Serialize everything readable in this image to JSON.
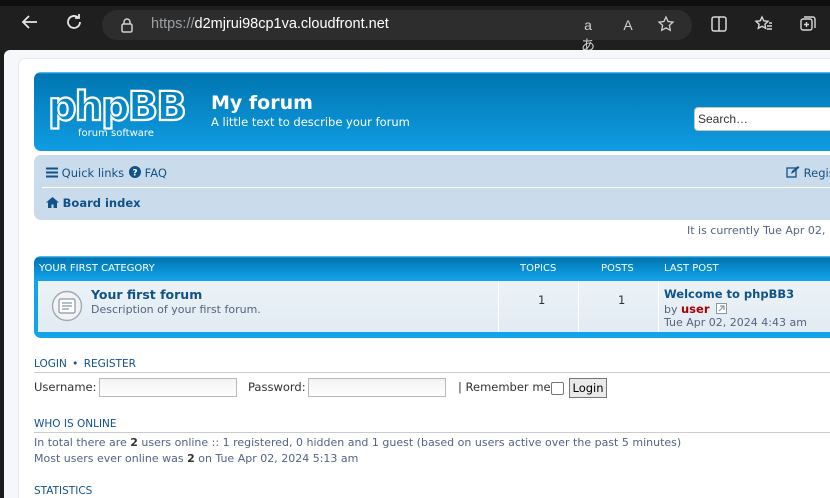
{
  "browser": {
    "url_scheme": "https://",
    "url_host": "d2mjrui98cp1va.cloudfront.net",
    "read_aloud_label": "A",
    "translate_label": "aあ"
  },
  "site": {
    "title": "My forum",
    "description": "A little text to describe your forum",
    "search_placeholder": "Search…",
    "logo_word": "phpBB",
    "logo_sub": "forum   software"
  },
  "navbar": {
    "quick_links": "Quick links",
    "faq": "FAQ",
    "register": "Regis",
    "board_index": "Board index"
  },
  "timestamp": "It is currently Tue Apr 02,",
  "category": {
    "name": "YOUR FIRST CATEGORY",
    "col_topics": "TOPICS",
    "col_posts": "POSTS",
    "col_last_post": "LAST POST",
    "forums": [
      {
        "title": "Your first forum",
        "description": "Description of your first forum.",
        "topics": "1",
        "posts": "1",
        "last_post_title": "Welcome to phpBB3",
        "last_post_by": "by",
        "last_post_user": "user",
        "last_post_date": "Tue Apr 02, 2024 4:43 am"
      }
    ]
  },
  "login": {
    "login_link": "LOGIN",
    "separator": "•",
    "register_link": "REGISTER",
    "username_label": "Username:",
    "password_label": "Password:",
    "remember_label": "| Remember me",
    "submit": "Login"
  },
  "online": {
    "title": "WHO IS ONLINE",
    "line1_a": "In total there are ",
    "line1_count": "2",
    "line1_b": " users online :: 1 registered, 0 hidden and 1 guest (based on users active over the past 5 minutes)",
    "line2_a": "Most users ever online was ",
    "line2_count": "2",
    "line2_b": " on Tue Apr 02, 2024 5:13 am"
  },
  "statistics": {
    "title": "STATISTICS"
  },
  "colors": {
    "header_blue": "#12A3EB",
    "navbar_bg": "#cadceb",
    "link_blue": "#105289",
    "username_red": "#AA0000"
  }
}
